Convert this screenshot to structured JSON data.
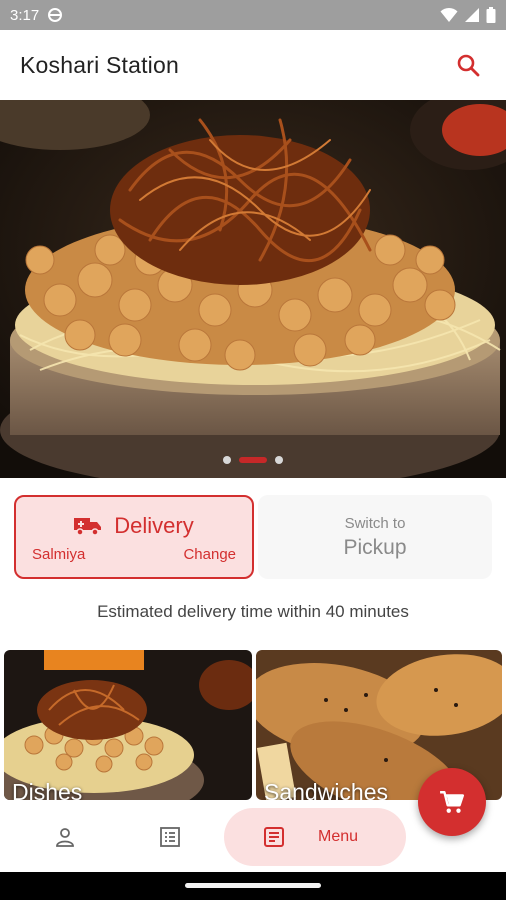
{
  "status_bar": {
    "time": "3:17"
  },
  "app_bar": {
    "title": "Koshari Station"
  },
  "hero": {
    "slides": 3,
    "active_slide": 2
  },
  "order_mode": {
    "delivery": {
      "label": "Delivery",
      "area": "Salmiya",
      "change_label": "Change",
      "selected": true
    },
    "pickup": {
      "prefix": "Switch to",
      "label": "Pickup",
      "selected": false
    }
  },
  "eta": "Estimated delivery time within 40 minutes",
  "categories": [
    {
      "label": "Dishes"
    },
    {
      "label": "Sandwiches"
    }
  ],
  "bottom_nav": {
    "items": [
      {
        "icon": "person-icon"
      },
      {
        "icon": "list-icon"
      },
      {
        "icon": "menu-icon",
        "label": "Menu",
        "active": true
      }
    ]
  },
  "colors": {
    "accent": "#d32f2f",
    "accent_light": "#fbe0e0"
  }
}
